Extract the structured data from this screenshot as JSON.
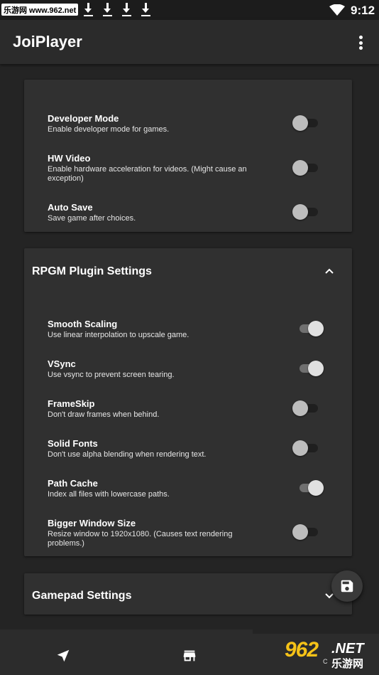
{
  "status_bar": {
    "watermark": "乐游网 www.962.net",
    "time": "9:12",
    "download_icons": [
      "download-icon",
      "download-icon",
      "download-icon",
      "download-icon"
    ],
    "wifi_icon": "wifi-icon"
  },
  "app_bar": {
    "title": "JoiPlayer",
    "menu_icon": "more-vert-icon"
  },
  "general_card": {
    "settings": [
      {
        "title": "Developer Mode",
        "desc": "Enable developer mode for games.",
        "enabled": false
      },
      {
        "title": "HW Video",
        "desc": "Enable hardware acceleration for videos. (Might cause an exception)",
        "enabled": false
      },
      {
        "title": "Auto Save",
        "desc": "Save game after choices.",
        "enabled": false
      }
    ]
  },
  "rpgm_card": {
    "title": "RPGM Plugin Settings",
    "expanded": true,
    "settings": [
      {
        "title": "Smooth Scaling",
        "desc": "Use linear interpolation to upscale game.",
        "enabled": true
      },
      {
        "title": "VSync",
        "desc": "Use vsync to prevent screen tearing.",
        "enabled": true
      },
      {
        "title": "FrameSkip",
        "desc": "Don't draw frames when behind.",
        "enabled": false
      },
      {
        "title": "Solid Fonts",
        "desc": "Don't use alpha blending when rendering text.",
        "enabled": false
      },
      {
        "title": "Path Cache",
        "desc": "Index all files with lowercase paths.",
        "enabled": true
      },
      {
        "title": "Bigger Window Size",
        "desc": "Resize window to 1920x1080. (Causes text rendering problems.)",
        "enabled": false
      }
    ]
  },
  "gamepad_card": {
    "title": "Gamepad Settings",
    "expanded": false
  },
  "fab": {
    "icon": "save-icon"
  },
  "bottom_nav": {
    "items": [
      {
        "icon": "navigation-arrow-icon"
      },
      {
        "icon": "store-icon"
      }
    ]
  },
  "watermark_bottom": {
    "number": "962",
    "net": ".NET",
    "chinese": "乐游网",
    "c": "C"
  },
  "colors": {
    "background": "#242424",
    "card": "#303030",
    "app_bar": "#2b2b2b",
    "switch_on_thumb": "#e0e0e0",
    "switch_off_thumb": "#bdbdbd",
    "watermark_accent": "#f5c218"
  }
}
